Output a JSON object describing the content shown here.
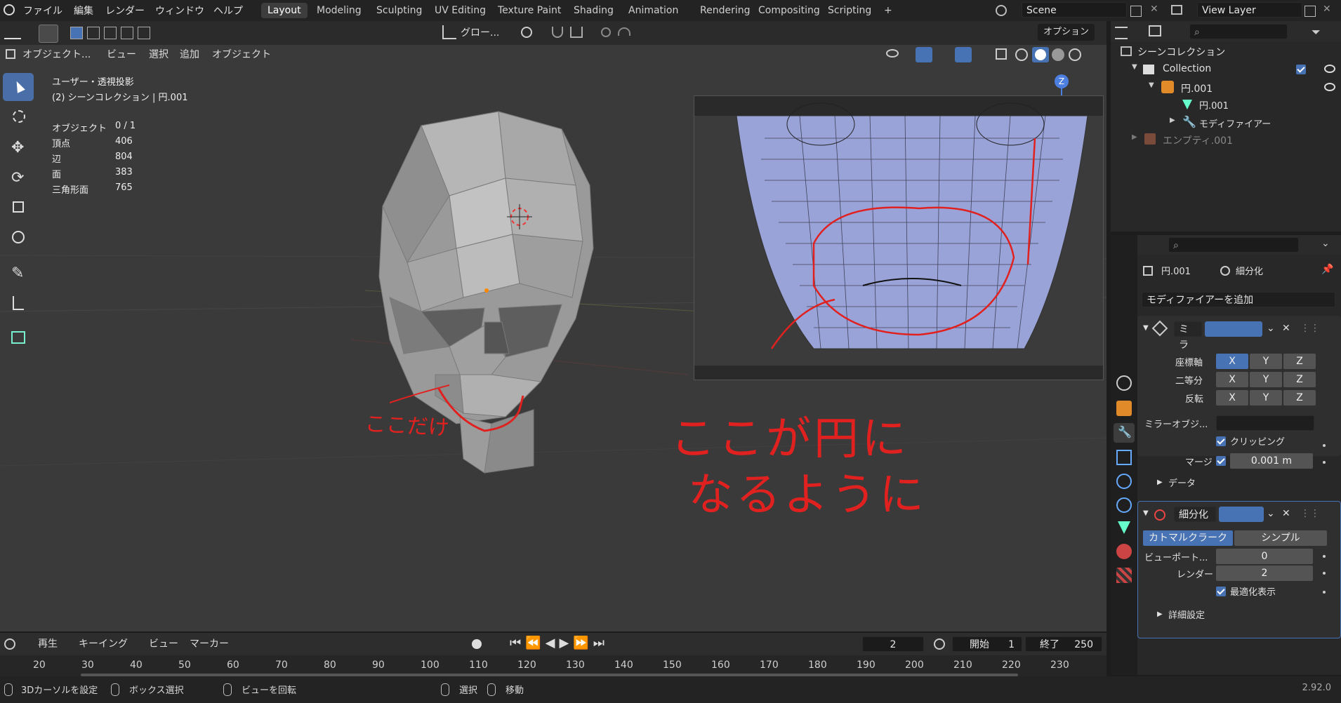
{
  "menu": {
    "file": "ファイル",
    "edit": "編集",
    "render": "レンダー",
    "window": "ウィンドウ",
    "help": "ヘルプ"
  },
  "workspaces": [
    "Layout",
    "Modeling",
    "Sculpting",
    "UV Editing",
    "Texture Paint",
    "Shading",
    "Animation",
    "Rendering",
    "Compositing",
    "Scripting"
  ],
  "active_workspace": "Layout",
  "scene": "Scene",
  "view_layer": "View Layer",
  "toolbar": {
    "transform_orientation": "グロー...",
    "options": "オプション"
  },
  "viewport_header": {
    "mode": "オブジェクト...",
    "view": "ビュー",
    "select": "選択",
    "add": "追加",
    "object": "オブジェクト"
  },
  "overlay": {
    "view_name": "ユーザー・透視投影",
    "collection_line": "(2) シーンコレクション | 円.001",
    "stats": [
      {
        "label": "オブジェクト",
        "value": "0 / 1"
      },
      {
        "label": "頂点",
        "value": "406"
      },
      {
        "label": "辺",
        "value": "804"
      },
      {
        "label": "面",
        "value": "383"
      },
      {
        "label": "三角形面",
        "value": "765"
      }
    ]
  },
  "annotations": {
    "small": "ここだけ",
    "big_line1": "ここが円に",
    "big_line2": "なるように"
  },
  "timeline": {
    "playback": "再生",
    "keying": "キーイング",
    "view": "ビュー",
    "marker": "マーカー",
    "current_frame": "2",
    "start_label": "開始",
    "start": "1",
    "end_label": "終了",
    "end": "250"
  },
  "ruler_ticks": [
    "20",
    "30",
    "40",
    "50",
    "60",
    "70",
    "80",
    "90",
    "100",
    "110",
    "120",
    "130",
    "140",
    "150",
    "160",
    "170",
    "180",
    "190",
    "200",
    "210",
    "220",
    "230"
  ],
  "status": {
    "cursor": "3Dカーソルを設定",
    "box": "ボックス選択",
    "rotate": "ビューを回転",
    "select": "選択",
    "move": "移動",
    "version": "2.92.0"
  },
  "outliner": {
    "root": "シーンコレクション",
    "collection": "Collection",
    "object": "円.001",
    "mesh": "円.001",
    "modifiers": "モディファイアー",
    "empty": "エンプティ.001"
  },
  "properties": {
    "object_name": "円.001",
    "modifier_name": "細分化",
    "add_modifier": "モディファイアーを追加",
    "mirror": {
      "name": "ミラ",
      "axis_label": "座標軸",
      "bisect_label": "二等分",
      "flip_label": "反転",
      "mirror_object_label": "ミラーオブジ...",
      "clipping": "クリッピング",
      "merge_label": "マージ",
      "merge_value": "0.001 m",
      "data": "データ"
    },
    "subsurf": {
      "name": "細分化",
      "catmull": "カトマルクラーク",
      "simple": "シンプル",
      "viewport_label": "ビューポート...",
      "viewport_value": "0",
      "render_label": "レンダー",
      "render_value": "2",
      "optimal": "最適化表示",
      "advanced": "詳細設定"
    }
  },
  "colors": {
    "accent": "#4772b3",
    "annotation_red": "#e0211f",
    "bg_viewport": "#3a3a3a"
  }
}
